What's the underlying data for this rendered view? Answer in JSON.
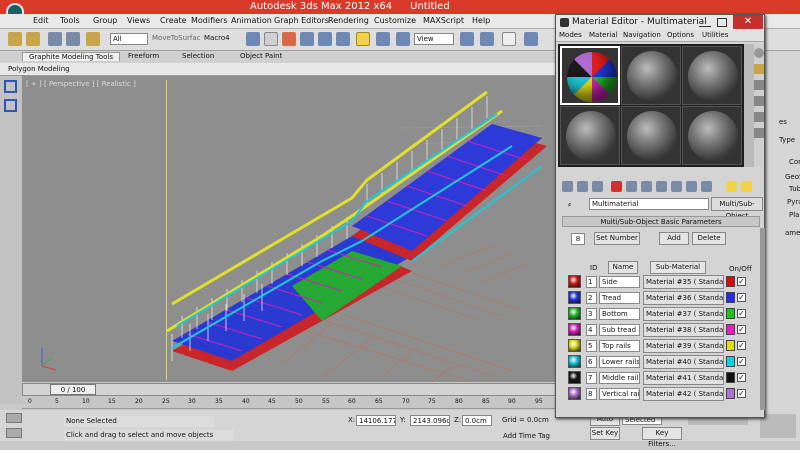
{
  "app": {
    "name": "Autodesk 3ds Max  2012 x64",
    "doc": "Untitled"
  },
  "menubar": [
    "Edit",
    "Tools",
    "Group",
    "Views",
    "Create",
    "Modifiers",
    "Animation",
    "Graph Editors",
    "Rendering",
    "Customize",
    "MAXScript",
    "Help"
  ],
  "toolbar": {
    "filter": "All",
    "command": "MoveToSurfac",
    "macro": "Macro4",
    "view": "View"
  },
  "ribbon": {
    "tabs": [
      "Graphite Modeling Tools",
      "Freeform",
      "Selection",
      "Object Paint"
    ],
    "sub": "Polygon Modeling"
  },
  "viewport": {
    "label": "[ + ] [ Perspective ] [ Realistic ]"
  },
  "timeline": {
    "frame": "0 / 100",
    "ticks": [
      "0",
      "5",
      "10",
      "15",
      "20",
      "25",
      "30",
      "35",
      "40",
      "45",
      "50",
      "55",
      "60",
      "65",
      "70",
      "75",
      "80",
      "85",
      "90",
      "95"
    ]
  },
  "status": {
    "selection": "None Selected",
    "prompt": "Click and drag to select and move objects",
    "x_label": "X:",
    "x_value": "14106.177",
    "y_label": "Y:",
    "y_value": "2143.096c",
    "z_label": "Z:",
    "z_value": "0.0cm",
    "grid": "Grid = 0.0cm",
    "autokey": "Auto Key",
    "setkey": "Set Key",
    "selected": "Selected",
    "keyfilters": "Key Filters...",
    "addtimetag": "Add Time Tag"
  },
  "right_panel": [
    "es",
    "Type",
    "Cor",
    "GeoS",
    "Tub",
    "Pyra",
    "Plan",
    "ame"
  ],
  "material_editor": {
    "title": "Material Editor - Multimaterial",
    "close": "✕",
    "menu": [
      "Modes",
      "Material",
      "Navigation",
      "Options",
      "Utilities"
    ],
    "material_name": "Multimaterial",
    "material_type": "Multi/Sub-Object",
    "rollout": "Multi/Sub-Object Basic Parameters",
    "num_materials": "8",
    "set_number": "Set Number",
    "add": "Add",
    "delete": "Delete",
    "headers": {
      "id": "ID",
      "name": "Name",
      "sub": "Sub-Material",
      "onoff": "On/Off"
    },
    "rows": [
      {
        "id": "1",
        "name": "Side",
        "sub": "Material #35  ( Standard )",
        "swatch": "#d01515",
        "color": "#cc1010"
      },
      {
        "id": "2",
        "name": "Tread",
        "sub": "Material #36  ( Standard )",
        "swatch": "#1f33d8",
        "color": "#2030e0"
      },
      {
        "id": "3",
        "name": "Bottom",
        "sub": "Material #37  ( Standard )",
        "swatch": "#22b92b",
        "color": "#20c020"
      },
      {
        "id": "4",
        "name": "Sub tread",
        "sub": "Material #38  ( Standard )",
        "swatch": "#d61fb9",
        "color": "#e020c0"
      },
      {
        "id": "5",
        "name": "Top rails",
        "sub": "Material #39  ( Standard )",
        "swatch": "#d8d417",
        "color": "#e0e010"
      },
      {
        "id": "6",
        "name": "Lower rails",
        "sub": "Material #40  ( Standard )",
        "swatch": "#18c2d2",
        "color": "#10d0e0"
      },
      {
        "id": "7",
        "name": "Middle rail",
        "sub": "Material #41  ( Standard )",
        "swatch": "#151515",
        "color": "#101010"
      },
      {
        "id": "8",
        "name": "Vertical rai",
        "sub": "Material #42  ( Standard )",
        "swatch": "#a46ac2",
        "color": "#b070d0"
      }
    ]
  }
}
